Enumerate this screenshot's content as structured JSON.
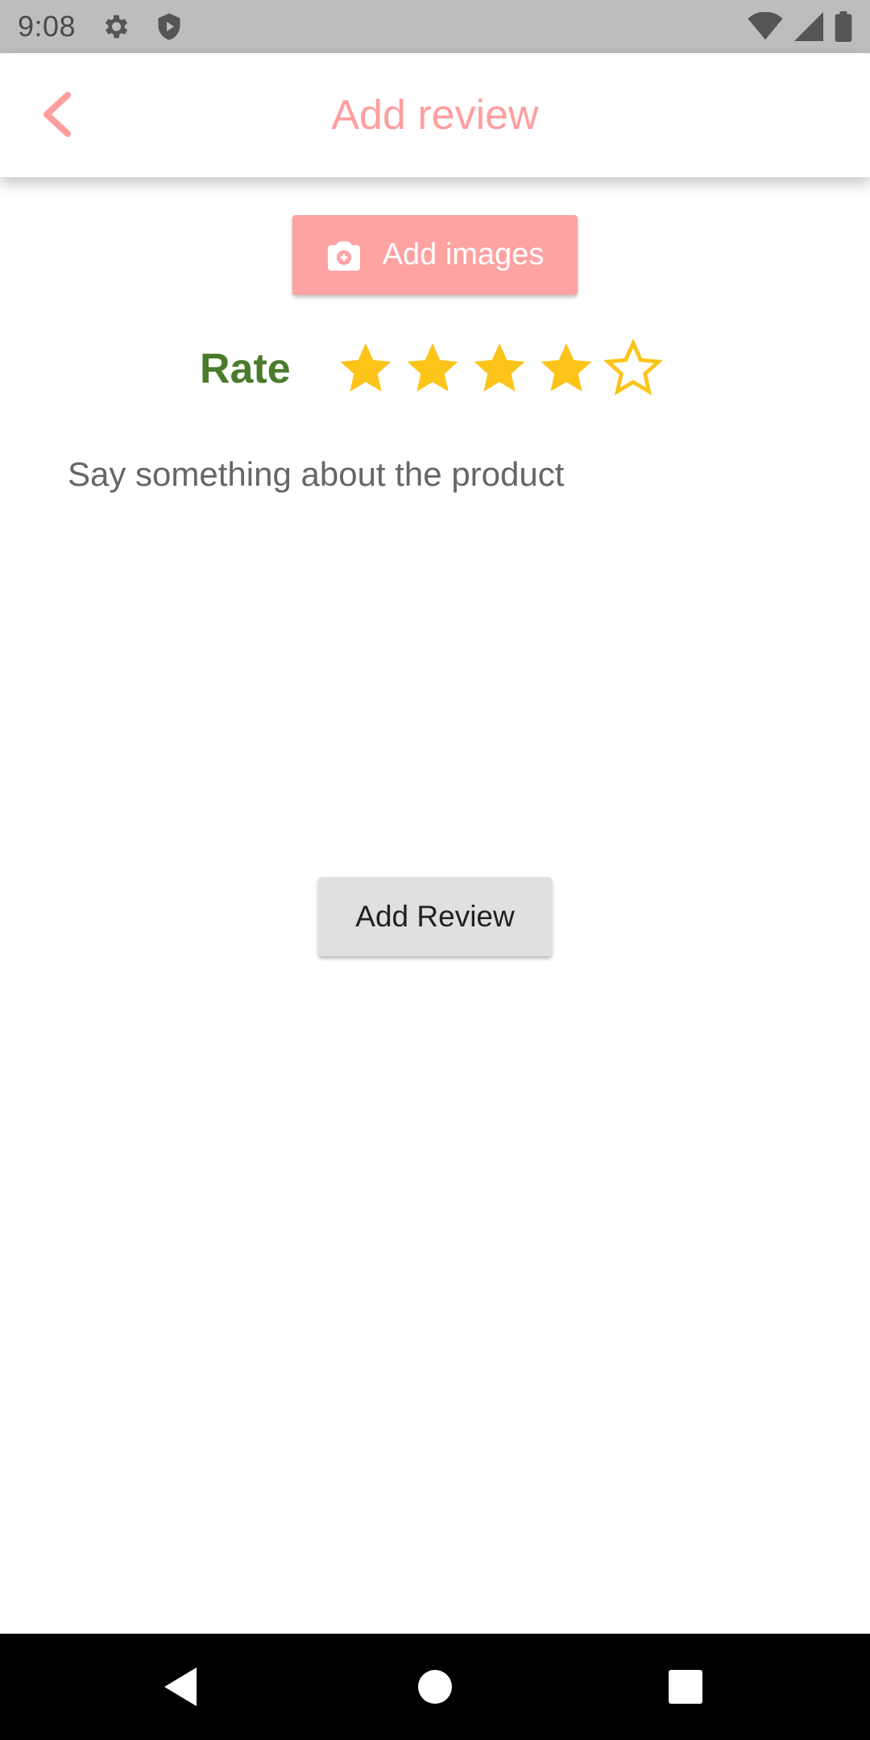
{
  "status_bar": {
    "time": "9:08",
    "left_icons": [
      "gear-icon",
      "shield-icon"
    ],
    "right_icons": [
      "wifi-icon",
      "cellular-signal-icon",
      "battery-icon"
    ]
  },
  "app_bar": {
    "title": "Add review",
    "back_icon": "chevron-left-icon",
    "accent_color": "#ff9e9e"
  },
  "add_images": {
    "label": "Add images",
    "icon": "camera-add-icon",
    "background": "#ffa2a2"
  },
  "rating": {
    "label": "Rate",
    "label_color": "#4a7a2b",
    "value": 4,
    "max": 5,
    "star_color": "#fcc419"
  },
  "review": {
    "placeholder": "Say something about the product",
    "value": ""
  },
  "submit": {
    "label": "Add Review"
  },
  "nav_bar": {
    "buttons": [
      "back-triangle-icon",
      "home-circle-icon",
      "recents-square-icon"
    ]
  }
}
